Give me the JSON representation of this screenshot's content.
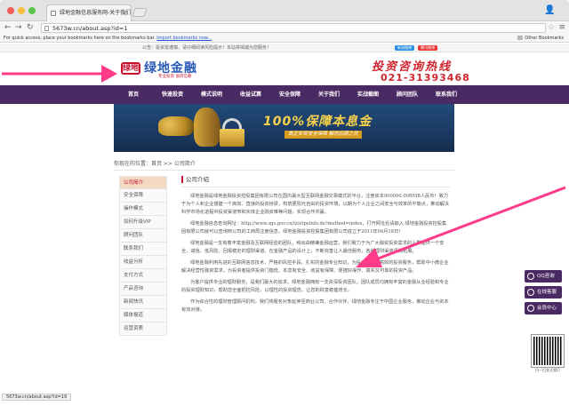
{
  "browser": {
    "tab_title": "绿地金融信息服务网-关于我们",
    "url": "5673w.cn/about.asp?id=1",
    "bookmarks_hint": "For quick access, place your bookmarks here on the bookmarks bar.",
    "bookmarks_link": "Import bookmarks now...",
    "other_bookmarks": "Other Bookmarks",
    "status_url": "5673w.cn/about.asp?id=19"
  },
  "topstrip": {
    "notice": "公告：投资需谨慎，请仔细阅读风险提示！本站将竭诚为您服务！",
    "weibo_a": "新浪微博",
    "weibo_b": "腾讯微博"
  },
  "header": {
    "logo_mark": "绿地",
    "logo_text": "绿地金融",
    "logo_sub": "专业投资 值得信赖",
    "hotline_label": "投资咨询热线",
    "hotline_number": "021-31393468"
  },
  "nav": [
    "首页",
    "快速投资",
    "模式说明",
    "收益试算",
    "安全保障",
    "关于我们",
    "实战截图",
    "顾问团队",
    "联系我们"
  ],
  "banner": {
    "headline": "100%保障本息金",
    "subline": "真正实现安全保障 解您后顾之忧"
  },
  "breadcrumb": "你现在的位置：首页 >> 公司简介",
  "sidebar": [
    "公司简介",
    "安全保障",
    "操作模式",
    "如何升级VIP",
    "顾问团队",
    "联系我们",
    "收益分析",
    "支付方式",
    "产品咨询",
    "新闻快讯",
    "媒体报道",
    "运营资质"
  ],
  "article": {
    "heading": "公司介绍",
    "paragraphs": [
      "绿地金融是绿地金融投资控股集团有限公司在国内最大型互联网金融交易模式的平台，注册资本900000.00RMB人民币！致力于为个人和企业搭建一个高效、直接的投资桥梁，构筑更阳光自由的投资环境，以期为个人企业之间安全与效率的平衡点，推动解决科学市场化进程中投资渠道窄和实体企业融资难等问题，实现合作共赢。",
      "绿地金融信息查询网址：http://www.sgs.gov.cn/lz/etpsInfo.do?method=index，打开网址后请输入 绿地金融投资控股集团有限公司就可以查询到公司的工商局注册信息，绿地金融投资控股集团有限公司成立于2011年04月18日！",
      "绿地金融是一支有着丰富金融及互联网经验的团队，纯出由精兼金融运营，我们致力于为广大融资投资需求的人群提供一个安全、诚信、低风险、回报稳定的理财渠道。在金融产品的设计上，不断完善让人最佳服务，各种理财渠道逐渐拓展。",
      "绿地金融利用先进的互联网信息技术，严格的风控手段，扎实的金融专业知识，为投资人提供高效的投资服务，帮助中小微企业解决经营性融资需求，为投资者提供投资门槛低、本息有安全、收益有保障、便捷好操作、真实又可靠的投资产品。",
      "为客户提供专业的理财服务，是我们最大的追求。绿地金融拥有一支资深投资团队，团队成员均拥有丰富的金融从业经验和专业的投资理财知识，帮助您全面把控风险，以理性的投资理念，让您的财富稳健增长。",
      "作为综合性的理财管理顾问机构，我们将服务对象延伸至商业公司、合作伙伴，绿地金融专注于中国企业服务，推动企业与资本有效对接。"
    ]
  },
  "widgets": [
    "QQ咨询",
    "在线客服",
    "会员中心"
  ],
  "qr_caption": "扫一扫关注我们"
}
